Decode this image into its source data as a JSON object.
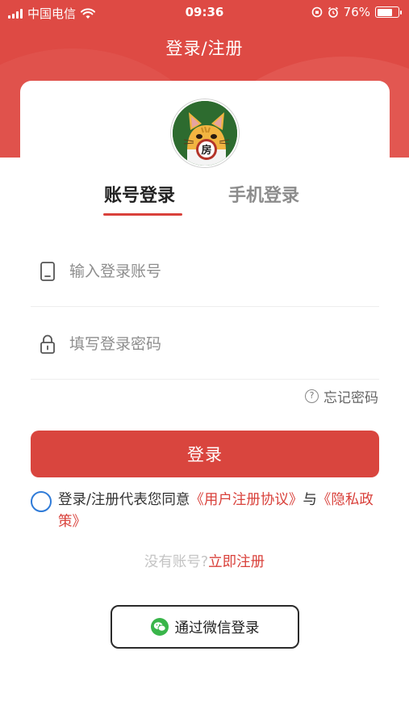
{
  "status_bar": {
    "carrier": "中国电信",
    "time": "09:36",
    "battery": "76%",
    "battery_level": 0.76
  },
  "header": {
    "title": "登录/注册"
  },
  "logo": {
    "badge_text": "房"
  },
  "tabs": [
    {
      "label": "账号登录",
      "active": true
    },
    {
      "label": "手机登录",
      "active": false
    }
  ],
  "form": {
    "account": {
      "placeholder": "输入登录账号",
      "value": ""
    },
    "password": {
      "placeholder": "填写登录密码",
      "value": ""
    },
    "forgot_label": "忘记密码",
    "forgot_icon_glyph": "?"
  },
  "login_button": {
    "label": "登录"
  },
  "agreement": {
    "checked": false,
    "text_before": "登录/注册代表您同意",
    "user_agreement": "《用户注册协议》",
    "joiner": "与",
    "privacy_policy": "《隐私政策》"
  },
  "register": {
    "prompt": "没有账号?",
    "link": "立即注册"
  },
  "wechat_login": {
    "label": "通过微信登录"
  },
  "colors": {
    "accent": "#d9453e",
    "link": "#d9413b",
    "radio": "#2f7bd8",
    "wechat": "#39b54a"
  }
}
